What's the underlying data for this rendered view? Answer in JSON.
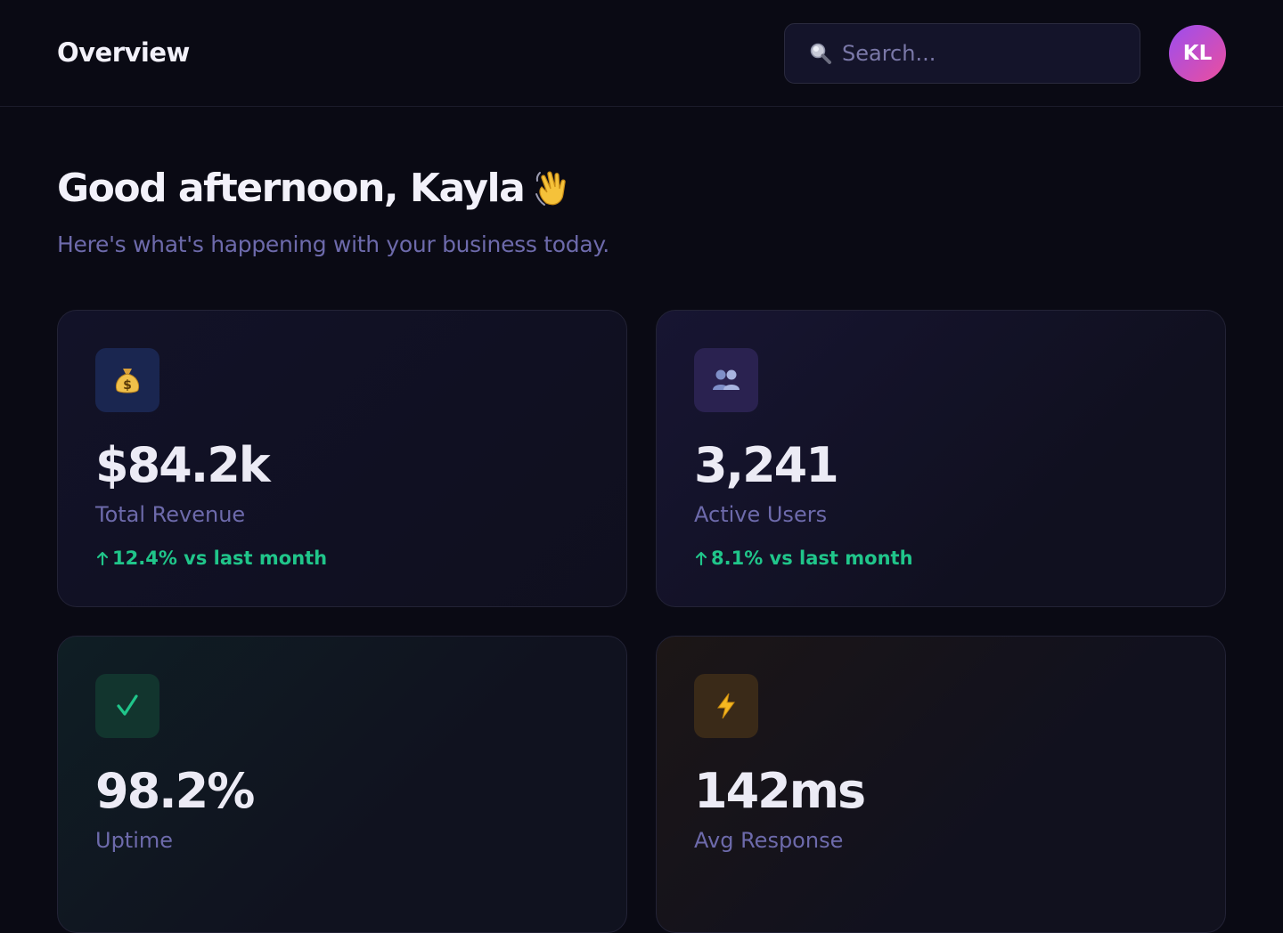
{
  "header": {
    "title": "Overview",
    "search_placeholder": "Search...",
    "avatar_initials": "KL"
  },
  "welcome": {
    "greeting": "Good afternoon, Kayla",
    "subtitle": "Here's what's happening with your business today."
  },
  "metrics": [
    {
      "icon": "money-bag-icon",
      "value": "$84.2k",
      "label": "Total Revenue",
      "trend": "12.4% vs last month",
      "trend_direction": "up"
    },
    {
      "icon": "users-icon",
      "value": "3,241",
      "label": "Active Users",
      "trend": "8.1% vs last month",
      "trend_direction": "up"
    },
    {
      "icon": "checkmark-icon",
      "value": "98.2%",
      "label": "Uptime"
    },
    {
      "icon": "lightning-icon",
      "value": "142ms",
      "label": "Avg Response"
    }
  ],
  "colors": {
    "background": "#0a0a14",
    "accent_positive": "#20c58a",
    "muted_text": "#6d6aab",
    "avatar_gradient": [
      "#9b4df0",
      "#ec4f9d"
    ]
  }
}
